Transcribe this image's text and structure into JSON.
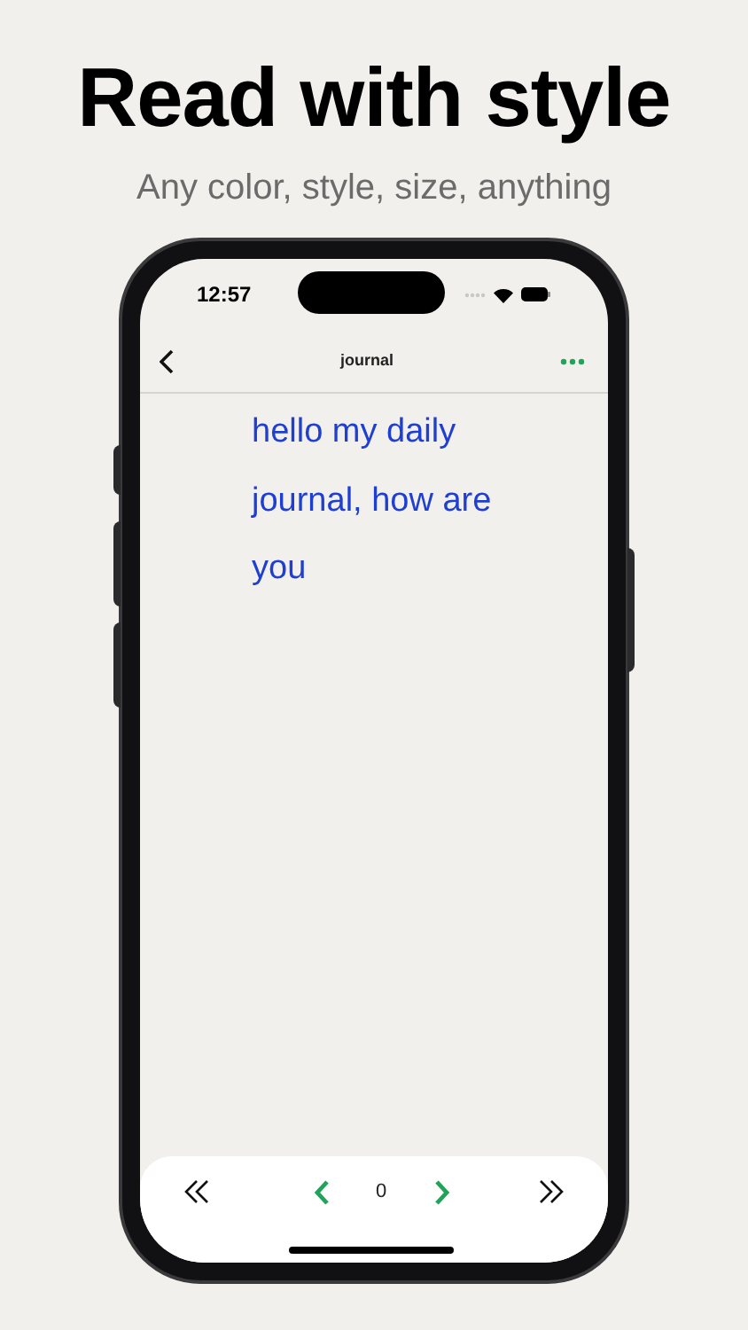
{
  "headline": "Read with style",
  "subtitle": "Any color, style, size, anything",
  "phone": {
    "status_bar": {
      "time": "12:57"
    },
    "nav_bar": {
      "title": "journal"
    },
    "document": {
      "text": "hello my daily journal, how are you"
    },
    "pager": {
      "page": "0"
    }
  }
}
